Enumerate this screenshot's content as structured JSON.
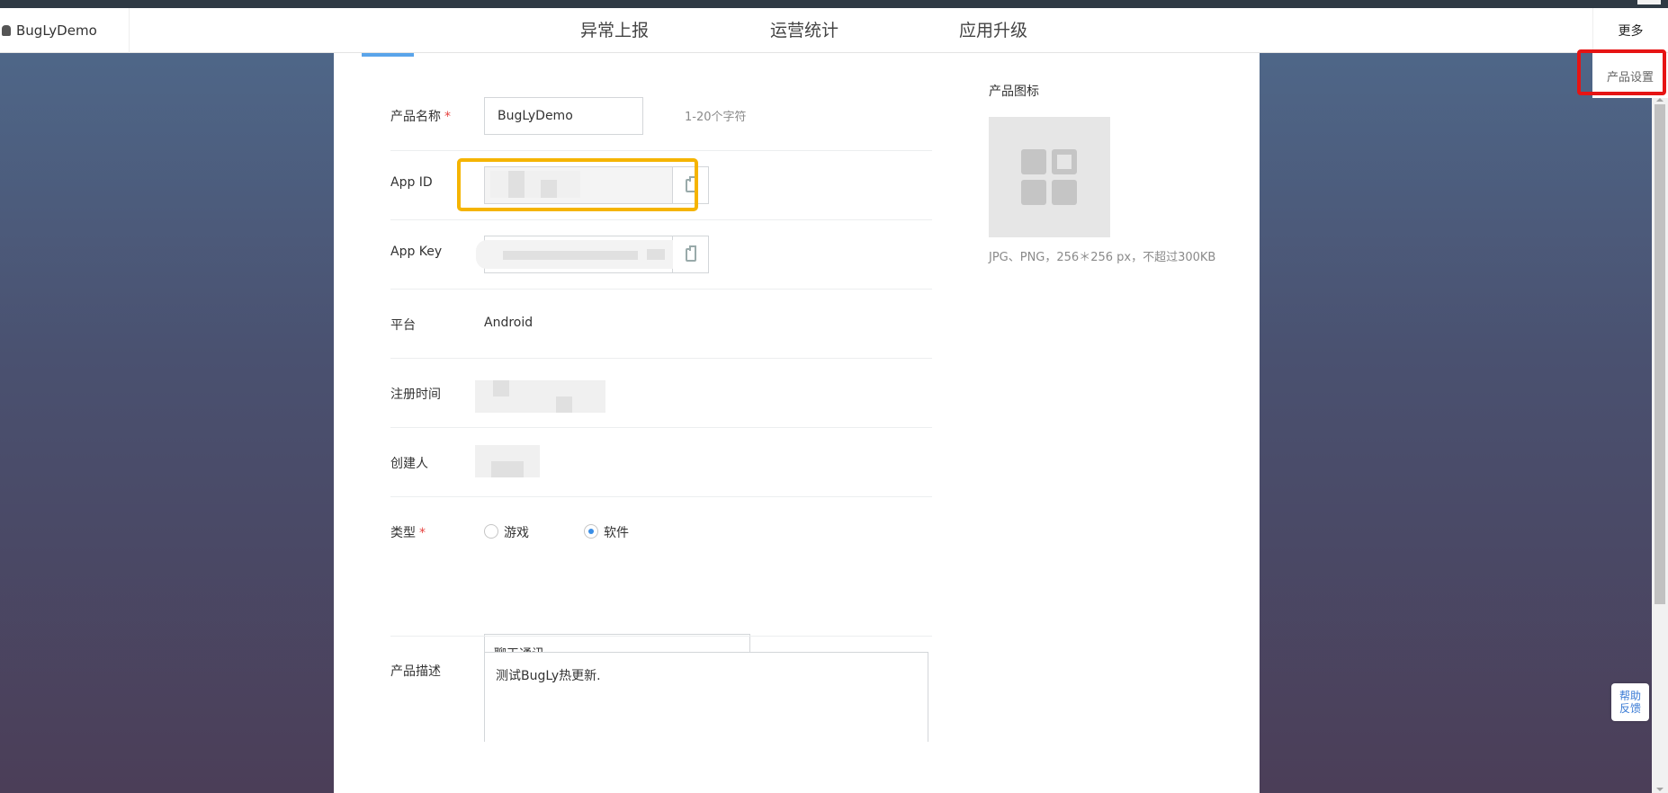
{
  "brand": {
    "name": "BugLyDemo",
    "icon": "android-icon"
  },
  "nav": {
    "tabs": [
      "异常上报",
      "运营统计",
      "应用升级"
    ],
    "more": "更多"
  },
  "dropdown": {
    "product_settings": "产品设置"
  },
  "form": {
    "product_name": {
      "label": "产品名称",
      "required": "*",
      "value": "BugLyDemo",
      "hint": "1-20个字符"
    },
    "app_id": {
      "label": "App ID",
      "copy_icon": "clipboard-icon"
    },
    "app_key": {
      "label": "App Key",
      "copy_icon": "clipboard-icon"
    },
    "platform": {
      "label": "平台",
      "value": "Android"
    },
    "register_time": {
      "label": "注册时间"
    },
    "creator": {
      "label": "创建人"
    },
    "type": {
      "label": "类型",
      "required": "*",
      "options": [
        {
          "label": "游戏",
          "checked": false
        },
        {
          "label": "软件",
          "checked": true
        }
      ],
      "category": "聊天通讯"
    },
    "description": {
      "label": "产品描述",
      "value": "测试BugLy热更新."
    }
  },
  "product_icon": {
    "title": "产品图标",
    "hint": "JPG、PNG，256＊256 px，不超过300KB"
  },
  "help": {
    "label": "帮助反馈"
  },
  "colors": {
    "highlight_red": "#e61414",
    "highlight_yellow": "#f5b400",
    "accent": "#5aa4ea",
    "radio_checked": "#3a8ee6"
  }
}
